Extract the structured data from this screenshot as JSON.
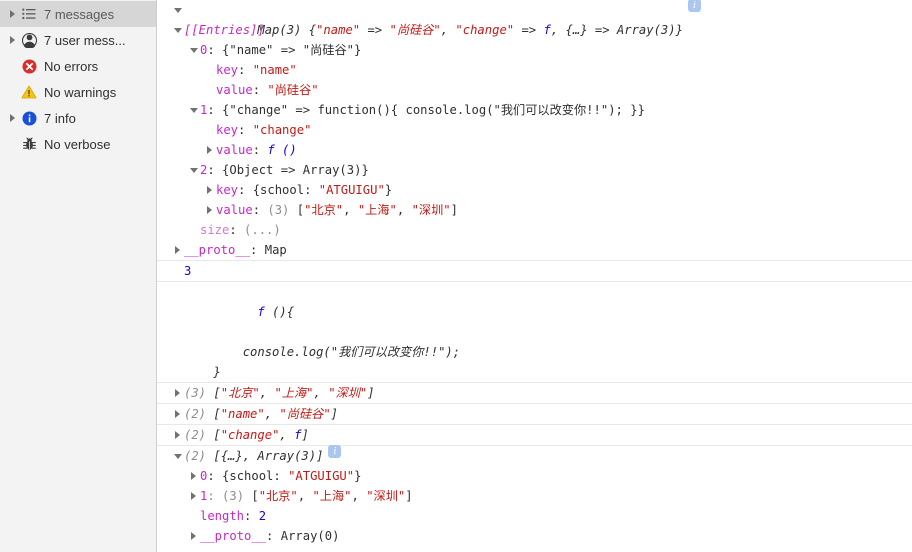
{
  "sidebar": {
    "items": [
      {
        "label": "7 messages",
        "icon": "list-icon",
        "expandable": true,
        "selected": true
      },
      {
        "label": "7 user mess...",
        "icon": "person-icon",
        "expandable": true,
        "selected": false
      },
      {
        "label": "No errors",
        "icon": "error-icon",
        "expandable": false,
        "selected": false
      },
      {
        "label": "No warnings",
        "icon": "warning-icon",
        "expandable": false,
        "selected": false
      },
      {
        "label": "7 info",
        "icon": "info-icon",
        "expandable": true,
        "selected": false
      },
      {
        "label": "No verbose",
        "icon": "bug-icon",
        "expandable": false,
        "selected": false
      }
    ]
  },
  "colors": {
    "string": "#c41a16",
    "number": "#1c00cf",
    "property": "#c528c5",
    "getter": "#cc7dcc",
    "plain": "#303030",
    "grey": "#8d8d8d",
    "info_badge": "#aac7f0",
    "error_red": "#dd2c2c",
    "warning_yellow": "#f5c518",
    "info_blue": "#1a73e8",
    "sidebar_bg": "#f3f3f3",
    "sidebar_selected": "#d6d6d6",
    "row_divider": "#e8e8e8"
  },
  "console": {
    "map_header": {
      "prefix": "Map(3) ",
      "brace_open": "{",
      "k1": "\"name\"",
      "arrow1": " => ",
      "v1": "\"尚硅谷\"",
      "sep1": ", ",
      "k2": "\"change\"",
      "arrow2": " => ",
      "v2": "f",
      "sep2": ", ",
      "k3": "{…}",
      "arrow3": " => ",
      "v3": "Array(3)",
      "brace_close": "}",
      "badge": "i"
    },
    "entries_label": "[[Entries]]",
    "entry0": {
      "index": "0",
      "colon": ": ",
      "summary_open": "{",
      "key_str": "\"name\"",
      "arrow": " => ",
      "val_str": "\"尚硅谷\"",
      "summary_close": "}",
      "key_prop": "key",
      "key_val": "\"name\"",
      "value_prop": "value",
      "value_val": "\"尚硅谷\""
    },
    "entry1": {
      "index": "1",
      "colon": ": ",
      "summary_open": "{",
      "key_str": "\"change\"",
      "arrow": " => ",
      "fn_text": "function(){ console.log(\"我们可以改变你!!\"); }",
      "summary_close": "}",
      "key_prop": "key",
      "key_val": "\"change\"",
      "value_prop": "value",
      "value_fn": "f ()"
    },
    "entry2": {
      "index": "2",
      "colon": ": ",
      "summary": "{Object => Array(3)}",
      "key_prop": "key",
      "key_obj_open": "{school: ",
      "key_obj_str": "\"ATGUIGU\"",
      "key_obj_close": "}",
      "value_prop": "value",
      "value_count": "(3) ",
      "value_arr_open": "[",
      "value_a1": "\"北京\"",
      "value_a2": "\"上海\"",
      "value_a3": "\"深圳\"",
      "value_arr_close": "]"
    },
    "size_prop": "size",
    "size_val": "(...)",
    "proto_map_prop": "__proto__",
    "proto_map_val": "Map",
    "number_result": "3",
    "function_dump": {
      "f_glyph": "f",
      "signature": " (){",
      "body": "        console.log(\"我们可以改变你!!\");",
      "close": "    }"
    },
    "arr_cities": {
      "count": "(3) ",
      "open": "[",
      "a1": "\"北京\"",
      "a2": "\"上海\"",
      "a3": "\"深圳\"",
      "close": "]"
    },
    "arr_name": {
      "count": "(2) ",
      "open": "[",
      "a1": "\"name\"",
      "a2": "\"尚硅谷\"",
      "close": "]"
    },
    "arr_change": {
      "count": "(2) ",
      "open": "[",
      "a1": "\"change\"",
      "sep": ", ",
      "a2": "f",
      "close": "]"
    },
    "arr_mixed": {
      "count": "(2) ",
      "open": "[",
      "a1": "{…}",
      "sep": ", ",
      "a2": "Array(3)",
      "close": "]",
      "badge": "i",
      "item0_index": "0",
      "item0_open": ": {school: ",
      "item0_str": "\"ATGUIGU\"",
      "item0_close": "}",
      "item1_index": "1",
      "item1_count": ": (3) ",
      "item1_open": "[",
      "item1_a1": "\"北京\"",
      "item1_a2": "\"上海\"",
      "item1_a3": "\"深圳\"",
      "item1_close": "]",
      "length_prop": "length",
      "length_val": "2",
      "proto_prop": "__proto__",
      "proto_val": "Array(0)"
    }
  }
}
